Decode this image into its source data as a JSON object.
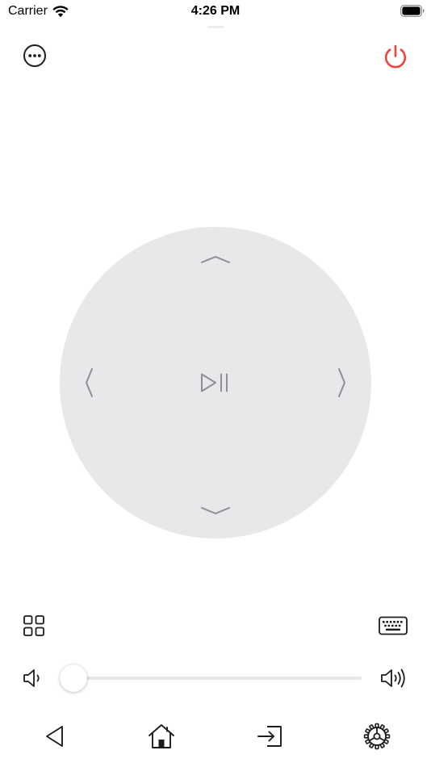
{
  "status_bar": {
    "carrier": "Carrier",
    "time": "4:26 PM"
  },
  "colors": {
    "power": "#ef4238",
    "dpad_background": "#e8e8ea",
    "dpad_icons": "#8e8e93",
    "icons": "#1c1c1e"
  },
  "icons": {
    "more": "ellipsis-circle-icon",
    "power": "power-icon",
    "dpad_up": "chevron-up-icon",
    "dpad_down": "chevron-down-icon",
    "dpad_left": "chevron-left-icon",
    "dpad_right": "chevron-right-icon",
    "dpad_center": "play-pause-icon",
    "apps": "grid-icon",
    "keyboard": "keyboard-icon",
    "volume_down": "speaker-low-icon",
    "volume_up": "speaker-high-icon",
    "back": "triangle-back-icon",
    "home": "house-icon",
    "input": "input-source-icon",
    "settings": "gear-icon"
  },
  "volume": {
    "level": 0.0
  }
}
